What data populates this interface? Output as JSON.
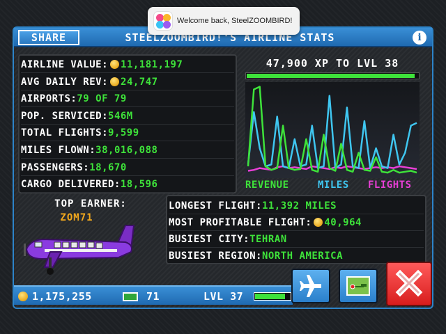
{
  "notification": {
    "text": "Welcome back, SteelZOOMBIRD!"
  },
  "header": {
    "share_label": "SHARE",
    "title": "STEELZOOMBIRD!'S AIRLINE STATS",
    "info_icon": "info-icon"
  },
  "stats": [
    {
      "label": "AIRLINE VALUE:",
      "value": "11,181,197",
      "coin": true
    },
    {
      "label": "AVG DAILY REV:",
      "value": "24,747",
      "coin": true
    },
    {
      "label": "AIRPORTS:",
      "value": "79 OF 79",
      "coin": false
    },
    {
      "label": "POP. SERVICED:",
      "value": "546M",
      "coin": false
    },
    {
      "label": "TOTAL FLIGHTS:",
      "value": "9,599",
      "coin": false
    },
    {
      "label": "MILES FLOWN:",
      "value": "38,016,088",
      "coin": false
    },
    {
      "label": "PASSENGERS:",
      "value": "18,670",
      "coin": false
    },
    {
      "label": "CARGO DELIVERED:",
      "value": "18,596",
      "coin": false
    }
  ],
  "xp": {
    "label": "47,900 XP TO LVL 38",
    "progress": 0.98
  },
  "chart_data": {
    "type": "line",
    "x": [
      1,
      2,
      3,
      4,
      5,
      6,
      7,
      8,
      9,
      10,
      11,
      12,
      13,
      14,
      15,
      16,
      17,
      18,
      19,
      20,
      21,
      22,
      23,
      24,
      25,
      26,
      27,
      28,
      29,
      30
    ],
    "series": [
      {
        "name": "REVENUE",
        "color": "#3ee23a",
        "values": [
          10,
          95,
          98,
          10,
          6,
          8,
          55,
          8,
          6,
          7,
          40,
          6,
          4,
          45,
          8,
          5,
          35,
          6,
          4,
          25,
          6,
          5,
          20,
          4,
          3,
          6,
          3,
          4,
          5,
          3
        ]
      },
      {
        "name": "MILES",
        "color": "#3fc6f0",
        "values": [
          12,
          70,
          30,
          10,
          12,
          65,
          10,
          8,
          40,
          10,
          12,
          55,
          8,
          10,
          88,
          8,
          12,
          75,
          10,
          8,
          60,
          8,
          30,
          10,
          8,
          45,
          12,
          25,
          55,
          58
        ]
      },
      {
        "name": "FLIGHTS",
        "color": "#e83fd6",
        "values": [
          5,
          6,
          8,
          7,
          6,
          9,
          10,
          8,
          9,
          8,
          7,
          10,
          9,
          8,
          7,
          9,
          8,
          10,
          9,
          8,
          7,
          8,
          9,
          8,
          9,
          8,
          10,
          9,
          8,
          7
        ]
      }
    ],
    "ylim": [
      0,
      100
    ],
    "legend": [
      "REVENUE",
      "MILES",
      "FLIGHTS"
    ]
  },
  "top_earner": {
    "title": "TOP EARNER:",
    "name": "ZOM71"
  },
  "flight_stats": [
    {
      "label": "LONGEST FLIGHT:",
      "value": "11,392 MILES",
      "coin": false
    },
    {
      "label": "MOST PROFITABLE FLIGHT:",
      "value": "40,964",
      "coin": true
    },
    {
      "label": "BUSIEST CITY:",
      "value": "TEHRAN",
      "coin": false
    },
    {
      "label": "BUSIEST REGION:",
      "value": "NORTH AMERICA",
      "coin": false
    }
  ],
  "bottom_bar": {
    "coins": "1,175,255",
    "bux": "71",
    "level": "LVL 37",
    "level_progress": 0.85
  },
  "colors": {
    "accent": "#2d84c9",
    "green": "#3ee23a",
    "orange": "#f2a81d",
    "close": "#e02424"
  }
}
